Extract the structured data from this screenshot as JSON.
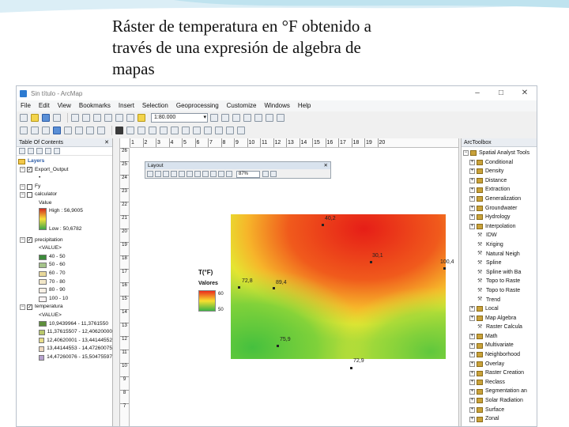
{
  "slide": {
    "title_lines": [
      "Ráster de temperatura en °F obtenido a",
      "través de una expresión de algebra de",
      "mapas"
    ]
  },
  "app": {
    "window_title": "Sin título - ArcMap",
    "menu": [
      "File",
      "Edit",
      "View",
      "Bookmarks",
      "Insert",
      "Selection",
      "Geoprocessing",
      "Customize",
      "Windows",
      "Help"
    ],
    "scale_value": "1:80.000"
  },
  "toc": {
    "title": "Table Of Contents",
    "root": "Layers",
    "layers": {
      "export_output": "Export_Output",
      "fy": "Fy",
      "calculator": {
        "name": "calculator",
        "value_label": "Value",
        "high": "High : 56,9005",
        "low": "Low : 50,6782"
      },
      "precipitation": {
        "name": "precipitation",
        "value_hdr": "<VALUE>",
        "classes": [
          "40 - 50",
          "50 - 60",
          "60 - 70",
          "70 - 80",
          "80 - 90",
          "100 - 10"
        ]
      },
      "temperatura": {
        "name": "temperatura",
        "value_hdr": "<VALUE>",
        "classes": [
          "10,9439964 - 11,3761550",
          "11,37615507 - 12,40620000",
          "12,40620001 - 13,44144552",
          "13,44144553 - 14,47260075",
          "14,47260076 - 15,50475597"
        ]
      }
    }
  },
  "colors": {
    "precip_classes": [
      "#3c8b3a",
      "#a5c48a",
      "#e8d89a",
      "#f2e7c8",
      "#f7efe4",
      "#f9f2f2"
    ],
    "temp_classes": [
      "#5e8f3c",
      "#b8c76c",
      "#e8dd8a",
      "#efd9c0",
      "#b7a2cf"
    ]
  },
  "layout_window": {
    "title": "Layout",
    "zoom": "87%"
  },
  "ruler": {
    "top": [
      "1",
      "2",
      "3",
      "4",
      "5",
      "6",
      "7",
      "8",
      "9",
      "10",
      "11",
      "12",
      "13",
      "14",
      "15",
      "16",
      "17",
      "18",
      "19",
      "20"
    ],
    "left": [
      "26",
      "25",
      "24",
      "23",
      "22",
      "21",
      "20",
      "19",
      "18",
      "17",
      "16",
      "15",
      "14",
      "13",
      "12",
      "11",
      "10",
      "9",
      "8",
      "7"
    ]
  },
  "map": {
    "legend_title": "T(°F)",
    "legend_sub": "Valores",
    "legend_high": "60",
    "legend_low": "50",
    "points": [
      {
        "id": "p1",
        "label": "40,2"
      },
      {
        "id": "p2",
        "label": "30,1"
      },
      {
        "id": "p3",
        "label": "100,4"
      },
      {
        "id": "p4",
        "label": "72,8"
      },
      {
        "id": "p5",
        "label": "89,4"
      },
      {
        "id": "p6",
        "label": "75,9"
      },
      {
        "id": "p7",
        "label": "72,9"
      }
    ]
  },
  "toolbox": {
    "title": "ArcToolbox",
    "root": "Spatial Analyst Tools",
    "items": [
      {
        "label": "Conditional",
        "level": 2,
        "icon": "toolbox"
      },
      {
        "label": "Density",
        "level": 2,
        "icon": "toolbox"
      },
      {
        "label": "Distance",
        "level": 2,
        "icon": "toolbox"
      },
      {
        "label": "Extraction",
        "level": 2,
        "icon": "toolbox"
      },
      {
        "label": "Generalization",
        "level": 2,
        "icon": "toolbox"
      },
      {
        "label": "Groundwater",
        "level": 2,
        "icon": "toolbox"
      },
      {
        "label": "Hydrology",
        "level": 2,
        "icon": "toolbox"
      },
      {
        "label": "Interpolation",
        "level": 2,
        "icon": "toolbox"
      },
      {
        "label": "IDW",
        "level": 3,
        "icon": "hammer"
      },
      {
        "label": "Kriging",
        "level": 3,
        "icon": "hammer"
      },
      {
        "label": "Natural Neigh",
        "level": 3,
        "icon": "hammer"
      },
      {
        "label": "Spline",
        "level": 3,
        "icon": "hammer"
      },
      {
        "label": "Spline with Ba",
        "level": 3,
        "icon": "hammer"
      },
      {
        "label": "Topo to Raste",
        "level": 3,
        "icon": "hammer"
      },
      {
        "label": "Topo to Raste",
        "level": 3,
        "icon": "hammer"
      },
      {
        "label": "Trend",
        "level": 3,
        "icon": "hammer"
      },
      {
        "label": "Local",
        "level": 2,
        "icon": "toolbox"
      },
      {
        "label": "Map Algebra",
        "level": 2,
        "icon": "toolbox"
      },
      {
        "label": "Raster Calcula",
        "level": 3,
        "icon": "hammer"
      },
      {
        "label": "Math",
        "level": 2,
        "icon": "toolbox"
      },
      {
        "label": "Multivariate",
        "level": 2,
        "icon": "toolbox"
      },
      {
        "label": "Neighborhood",
        "level": 2,
        "icon": "toolbox"
      },
      {
        "label": "Overlay",
        "level": 2,
        "icon": "toolbox"
      },
      {
        "label": "Raster Creation",
        "level": 2,
        "icon": "toolbox"
      },
      {
        "label": "Reclass",
        "level": 2,
        "icon": "toolbox"
      },
      {
        "label": "Segmentation an",
        "level": 2,
        "icon": "toolbox"
      },
      {
        "label": "Solar Radiation",
        "level": 2,
        "icon": "toolbox"
      },
      {
        "label": "Surface",
        "level": 2,
        "icon": "toolbox"
      },
      {
        "label": "Zonal",
        "level": 2,
        "icon": "toolbox"
      }
    ]
  }
}
